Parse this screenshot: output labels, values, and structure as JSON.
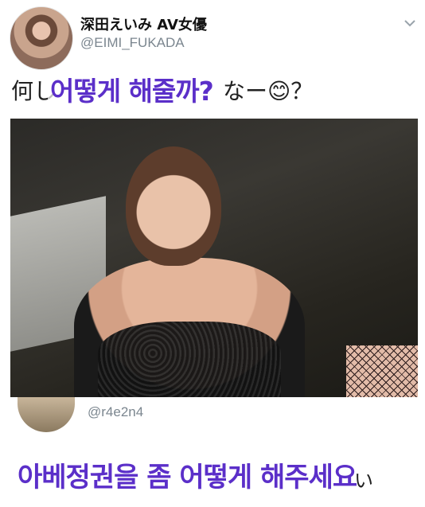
{
  "tweet": {
    "author": {
      "display_name": "深田えいみ AV女優",
      "handle": "@EIMI_FUKADA"
    },
    "text_visible": "何し",
    "text_tail": "なー",
    "emoji": "😊",
    "question": "？",
    "overlay_text_top": "어떻게 해줄까?"
  },
  "reply": {
    "handle": "@r4e2n4",
    "overlay_text_bottom": "아베정권을 좀 어떻게 해주세요",
    "tail": "い"
  },
  "icons": {
    "menu": "chevron-down-icon"
  },
  "colors": {
    "overlay_purple": "#5b2fc9",
    "handle_gray": "#7b868f"
  }
}
